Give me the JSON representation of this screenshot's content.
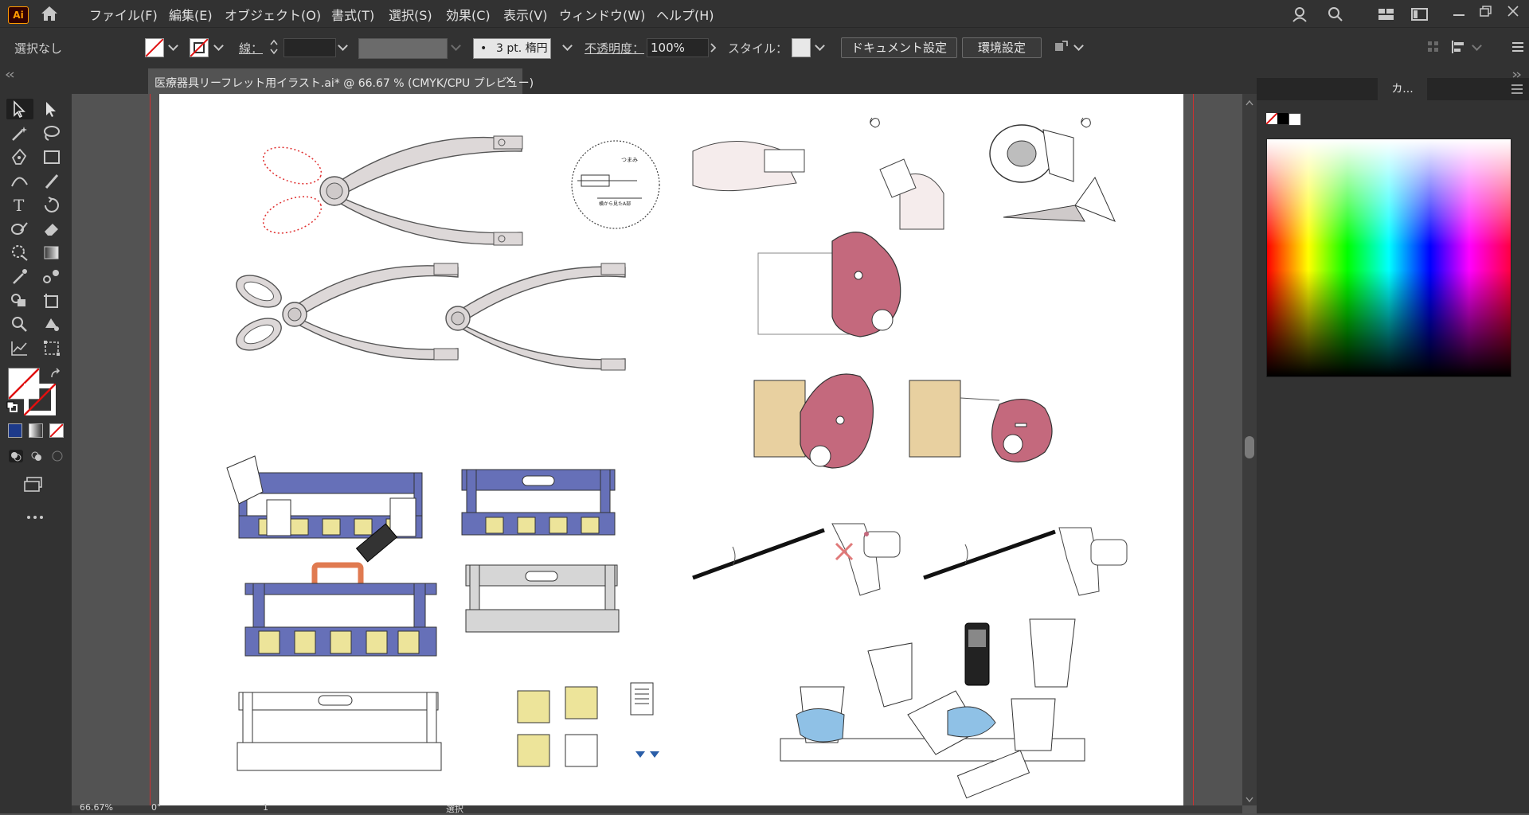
{
  "app": {
    "logo_text": "Ai"
  },
  "menu": {
    "items": [
      "ファイル(F)",
      "編集(E)",
      "オブジェクト(O)",
      "書式(T)",
      "選択(S)",
      "効果(C)",
      "表示(V)",
      "ウィンドウ(W)",
      "ヘルプ(H)"
    ]
  },
  "control_bar": {
    "selection": "選択なし",
    "stroke_label": "線：",
    "stroke_weight": "3 pt. 楕円",
    "opacity_label": "不透明度：",
    "opacity_value": "100%",
    "style_label": "スタイル：",
    "doc_settings": "ドキュメント設定",
    "preferences": "環境設定"
  },
  "document_tab": {
    "title": "医療器具リーフレット用イラスト.ai* @ 66.67 % (CMYK/CPU プレビュー)",
    "close": "×"
  },
  "right_panel": {
    "active_tab": "カ..."
  },
  "illustration_labels": {
    "tsumami": "つまみ",
    "side_view": "横から見たA部"
  },
  "status": {
    "zoom": "66.67%",
    "rotation": "0°",
    "page": "1",
    "mode": "選択"
  },
  "colors": {
    "accent_pink": "#c4697d",
    "tray_blue": "#6670b8",
    "clip_yellow": "#ede49a",
    "box_tan": "#e8d0a0",
    "water_blue": "#8fc1e6"
  }
}
